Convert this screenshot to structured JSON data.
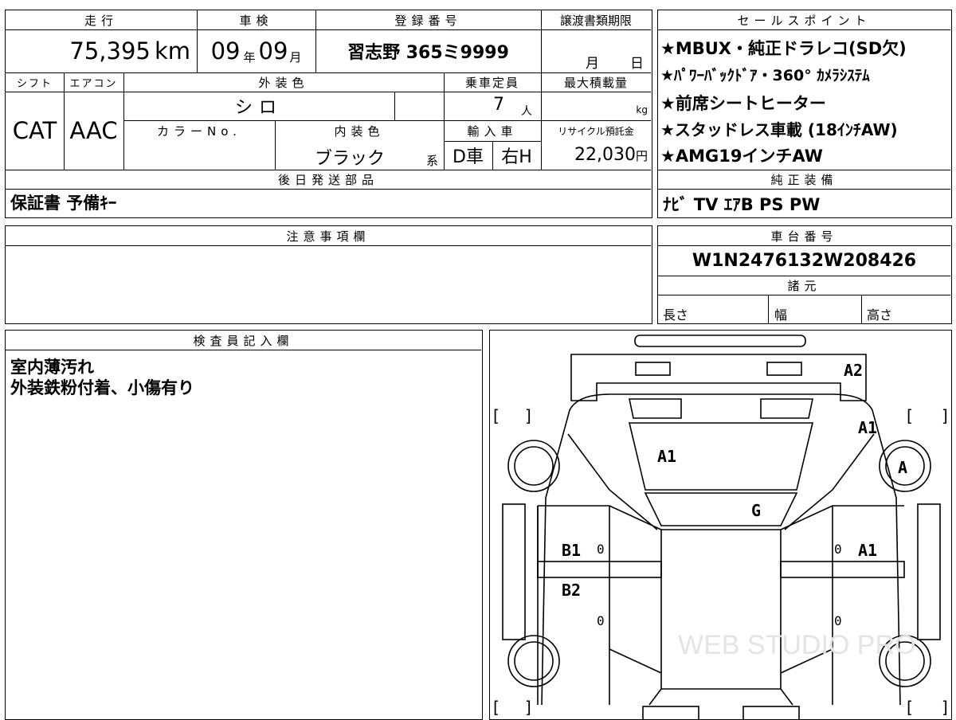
{
  "header": {
    "mileage_label": "走行",
    "inspection_label": "車検",
    "registration_label": "登録番号",
    "transfer_docs_label": "譲渡書類期限",
    "shift_label": "シフト",
    "aircon_label": "エアコン",
    "exterior_label": "外装色",
    "capacity_label": "乗車定員",
    "max_load_label": "最大積載量",
    "color_no_label": "カラーNo.",
    "interior_label": "内装色",
    "import_label": "輸入車",
    "recycle_label": "リサイクル預託金"
  },
  "vehicle": {
    "mileage": "75,395",
    "mileage_unit": "km",
    "inspection_year": "09",
    "year_unit": "年",
    "inspection_month": "09",
    "month_unit": "月",
    "plate": "習志野 365ミ9999",
    "transfer_month_unit": "月",
    "transfer_day_unit": "日",
    "shift": "CAT",
    "aircon": "AAC",
    "exterior_color": "シロ",
    "capacity": "7",
    "capacity_unit": "人",
    "load_unit": "kg",
    "interior_color": "ブラック",
    "interior_suffix": "系",
    "import_type": "D車",
    "handle": "右H",
    "recycle_fee": "22,030",
    "recycle_unit": "円"
  },
  "later_parts": {
    "label": "後日発送部品",
    "value": "保証書 予備ｷｰ"
  },
  "sales_points": {
    "label": "セールスポイント",
    "items": [
      "★MBUX・純正ドラレコ(SD欠)",
      "★ﾊﾟﾜｰﾊﾞｯｸﾄﾞｱ・360° ｶﾒﾗｼｽﾃﾑ",
      "★前席シートヒーター",
      "★スタッドレス車載 (18ｲﾝﾁAW)",
      "★AMG19インチAW"
    ]
  },
  "equipment": {
    "label": "純正装備",
    "value": "ﾅﾋﾞ TV ｴｱB PS PW"
  },
  "notes": {
    "label": "注意事項欄",
    "value": ""
  },
  "chassis": {
    "label": "車台番号",
    "value": "W1N2476132W208426"
  },
  "specs": {
    "label": "諸元",
    "length_label": "長さ",
    "width_label": "幅",
    "height_label": "高さ"
  },
  "inspector": {
    "label": "検査員記入欄",
    "lines": [
      "室内薄汚れ",
      "外装鉄粉付着、小傷有り"
    ]
  },
  "diagram": {
    "codes": {
      "rear": "A2",
      "right_rear_fender": "A1",
      "right_rear_wheel": "A",
      "roof": "A1",
      "windshield": "G",
      "left_rear_door": "B1",
      "right_rear_door": "A1",
      "left_front_door": "B2"
    },
    "watermark": "WEB STUDIO PRO"
  }
}
